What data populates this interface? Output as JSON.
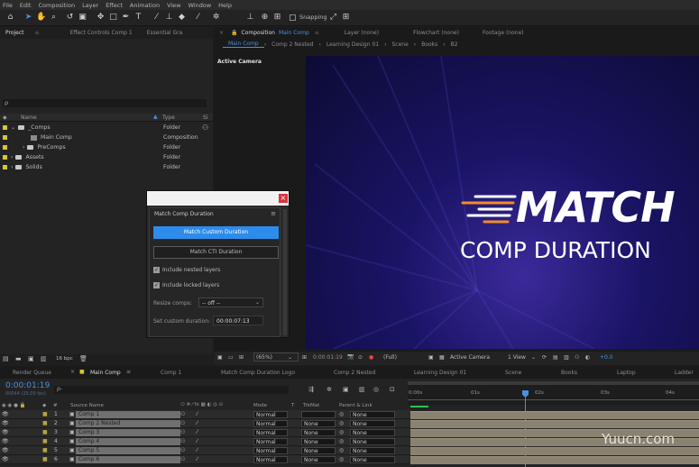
{
  "menu": [
    "File",
    "Edit",
    "Composition",
    "Layer",
    "Effect",
    "Animation",
    "View",
    "Window",
    "Help"
  ],
  "toolbar": {
    "snapping_label": "Snapping"
  },
  "project_panel": {
    "tabs": [
      "Project",
      "Effect Controls Comp 1",
      "Essential Gra"
    ],
    "search_placeholder": "ρ",
    "columns": {
      "name": "Name",
      "type": "Type",
      "size": "Si"
    },
    "items": [
      {
        "name": "_Comps",
        "type": "Folder"
      },
      {
        "name": "Main Comp",
        "type": "Composition"
      },
      {
        "name": "PreComps",
        "type": "Folder"
      },
      {
        "name": "Assets",
        "type": "Folder"
      },
      {
        "name": "Solids",
        "type": "Folder"
      }
    ],
    "bpc": "16 bpc"
  },
  "comp_panel": {
    "tabs": [
      "Composition",
      "Main Comp",
      "Layer (none)",
      "Flowchart (none)",
      "Footage (none)"
    ],
    "breadcrumbs": [
      "Main Comp",
      "Comp 2 Nested",
      "Learning Design 01",
      "Scene",
      "Books",
      "B2"
    ],
    "view_label": "Active Camera",
    "title_line1": "MATCH",
    "title_line2": "COMP DURATION",
    "footer": {
      "zoom": "(65%)",
      "time": "0:00:01:19",
      "res": "(Full)",
      "camera": "Active Camera",
      "views": "1 View",
      "exposure": "+0.0"
    }
  },
  "dialog": {
    "title": "Match Comp Duration",
    "primary_button": "Match Custom Duration",
    "secondary_button": "Match CTI Duration",
    "cb1": "Include nested layers",
    "cb2": "Include locked layers",
    "resize_label": "Resize comps:",
    "resize_value": "-- off --",
    "custom_label": "Set custom duration:",
    "custom_value": "00:00:07:13"
  },
  "timeline": {
    "tabs": [
      "Render Queue",
      "Main Comp",
      "Comp 1",
      "Match Comp Duration Logo",
      "Comp 2 Nested",
      "Learning Design 01",
      "Scene",
      "Books",
      "Laptop",
      "Ladder"
    ],
    "timecode": "0:00:01:19",
    "fps": "00044 (25.00 fps)",
    "search_placeholder": "ρ-",
    "ruler": [
      "0:00s",
      "01s",
      "02s",
      "03s",
      "04s"
    ],
    "headers": {
      "num": "#",
      "source": "Source Name",
      "mode": "Mode",
      "t": "T",
      "trkmat": "TrkMat",
      "parent": "Parent & Link"
    },
    "layers": [
      {
        "num": "1",
        "name": "Comp 1",
        "mode": "Normal",
        "trkmat": "",
        "parent": "None"
      },
      {
        "num": "2",
        "name": "Comp 2 Nested",
        "mode": "Normal",
        "trkmat": "None",
        "parent": "None"
      },
      {
        "num": "3",
        "name": "Comp 3",
        "mode": "Normal",
        "trkmat": "None",
        "parent": "None"
      },
      {
        "num": "4",
        "name": "Comp 4",
        "mode": "Normal",
        "trkmat": "None",
        "parent": "None"
      },
      {
        "num": "5",
        "name": "Comp 5",
        "mode": "Normal",
        "trkmat": "None",
        "parent": "None"
      },
      {
        "num": "6",
        "name": "Comp 6",
        "mode": "Normal",
        "trkmat": "None",
        "parent": "None"
      }
    ]
  },
  "watermark": "Yuucn.com"
}
